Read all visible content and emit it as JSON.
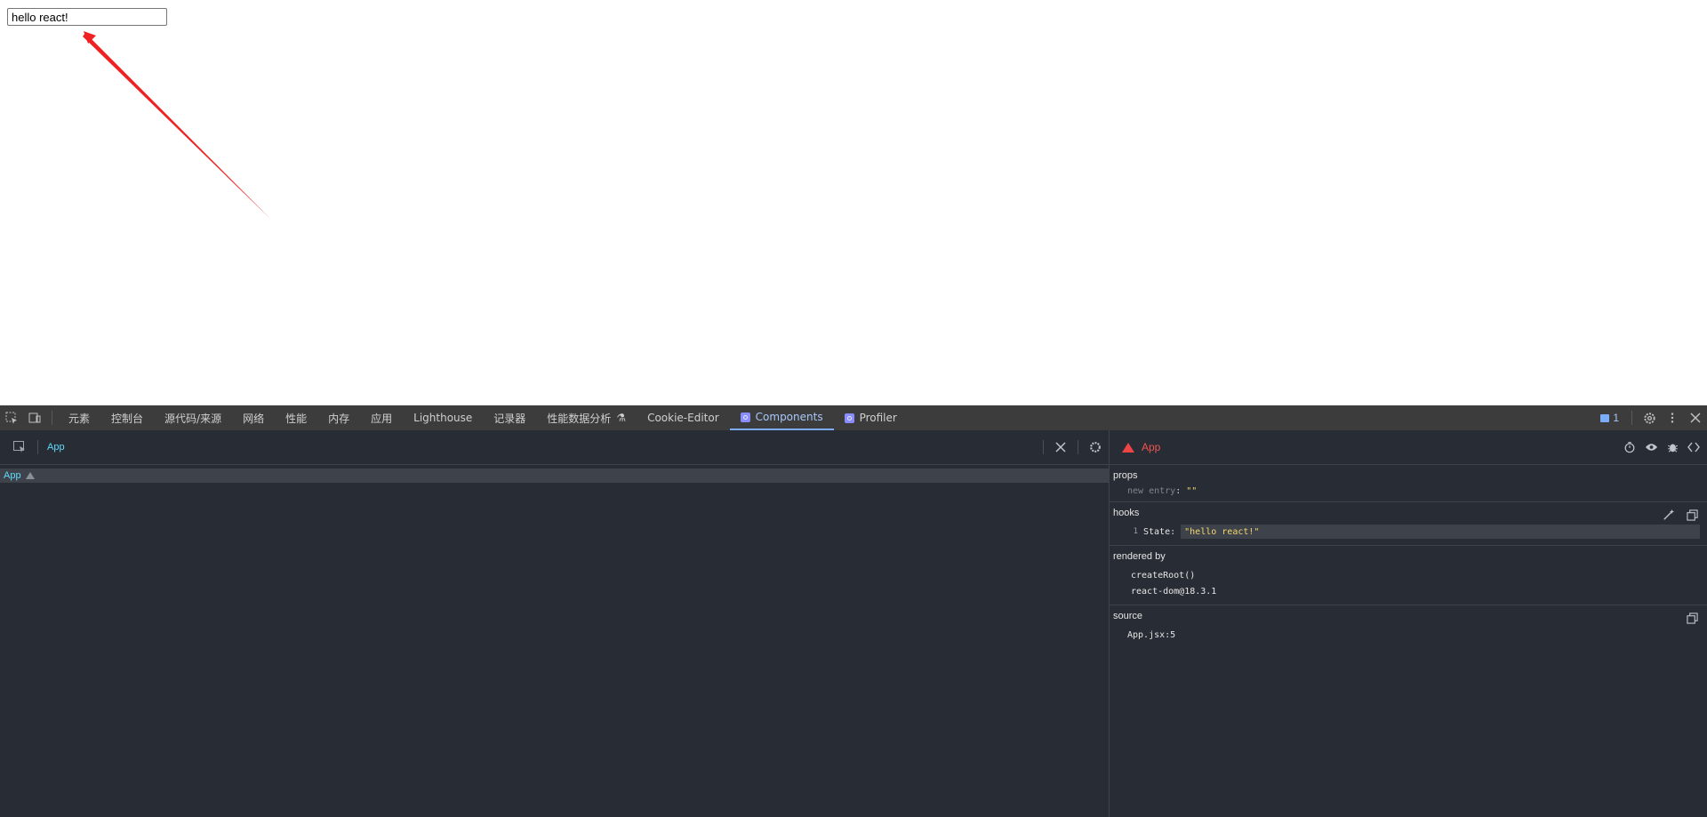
{
  "page": {
    "input_value": "hello react!"
  },
  "devtools": {
    "tabs": [
      {
        "label": "元素"
      },
      {
        "label": "控制台"
      },
      {
        "label": "源代码/来源"
      },
      {
        "label": "网络"
      },
      {
        "label": "性能"
      },
      {
        "label": "内存"
      },
      {
        "label": "应用"
      },
      {
        "label": "Lighthouse"
      },
      {
        "label": "记录器"
      },
      {
        "label": "性能数据分析"
      },
      {
        "label": "Cookie-Editor"
      },
      {
        "label": "Components"
      },
      {
        "label": "Profiler"
      }
    ],
    "active_tab": "Components",
    "issues_count": "1",
    "colors": {
      "accent": "#7cacf8",
      "react_blue": "#61dafb",
      "error_red": "#ef4444",
      "string_yellow": "#f5d76e"
    }
  },
  "components": {
    "breadcrumb": "App",
    "tree": [
      {
        "name": "App",
        "has_warning": true
      }
    ]
  },
  "inspector": {
    "title": "App",
    "props": {
      "title": "props",
      "new_entry_key": "new entry",
      "new_entry_value": "\"\""
    },
    "hooks": {
      "title": "hooks",
      "items": [
        {
          "index": "1",
          "key": "State",
          "value": "\"hello react!\""
        }
      ]
    },
    "rendered_by": {
      "title": "rendered by",
      "items": [
        "createRoot()",
        "react-dom@18.3.1"
      ]
    },
    "source": {
      "title": "source",
      "file": "App.jsx:5"
    }
  }
}
